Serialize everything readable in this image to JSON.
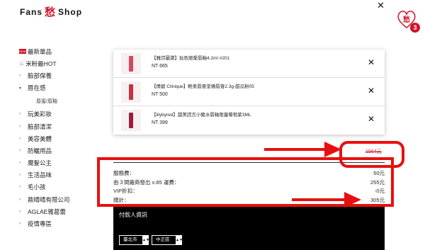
{
  "header": {
    "brand_left": "Fans",
    "brand_mark": "愁",
    "brand_right": "Shop",
    "cart_badge": "3",
    "cart_icon": "heart-cart-icon"
  },
  "sidebar": {
    "items": [
      {
        "label": "最新單品",
        "icon": "new-badge-icon",
        "badge": "NEW"
      },
      {
        "label": "米粉最HOT",
        "icon": "fire-icon"
      },
      {
        "label": "臉部保養",
        "prefix": "›"
      },
      {
        "label": "唇在感",
        "prefix": "▾"
      },
      {
        "label": "唇蜜/唇釉",
        "sub": true
      },
      {
        "label": "玩美彩妝",
        "prefix": "›"
      },
      {
        "label": "臉部清潔",
        "prefix": "›"
      },
      {
        "label": "美容美體",
        "prefix": "›"
      },
      {
        "label": "防曬用品",
        "prefix": "›"
      },
      {
        "label": "魔髮公主",
        "prefix": "›"
      },
      {
        "label": "生活品味",
        "prefix": "›"
      },
      {
        "label": "毛小孩",
        "prefix": "›"
      },
      {
        "label": "鼎晴晴有限公司",
        "prefix": "›"
      },
      {
        "label": "AGLAE雅葛蕾",
        "prefix": "›"
      },
      {
        "label": "疫情專區",
        "prefix": "›"
      }
    ]
  },
  "cart": {
    "items": [
      {
        "name": "【雅詩蘭黛】玩色戀愛唇釉4.2ml #201",
        "price": "NT 665",
        "color": "#d9455a"
      },
      {
        "name": "【倩碧 Clinique】輕柔唇膏塗鴉唇膏2.3g-甜瓜粉05",
        "price": "NT 500",
        "color": "#c93040"
      },
      {
        "name": "【lilybyred】甜美謊言小豬水唇釉限量葡萄紫3ML",
        "price": "NT 399",
        "color": "#a01d3a"
      }
    ],
    "original_total": "1564元"
  },
  "summary": {
    "rows": [
      {
        "label": "服務費：",
        "value": "50元"
      },
      {
        "label": "由３間廠商發出 x.85 運費：",
        "value": "255元"
      },
      {
        "label": "VIP折扣：",
        "value": "-0元"
      },
      {
        "label": "總計：",
        "value": "305元"
      }
    ]
  },
  "payer": {
    "title": "付款人資訊",
    "city": "臺北市",
    "district": "中正區"
  }
}
